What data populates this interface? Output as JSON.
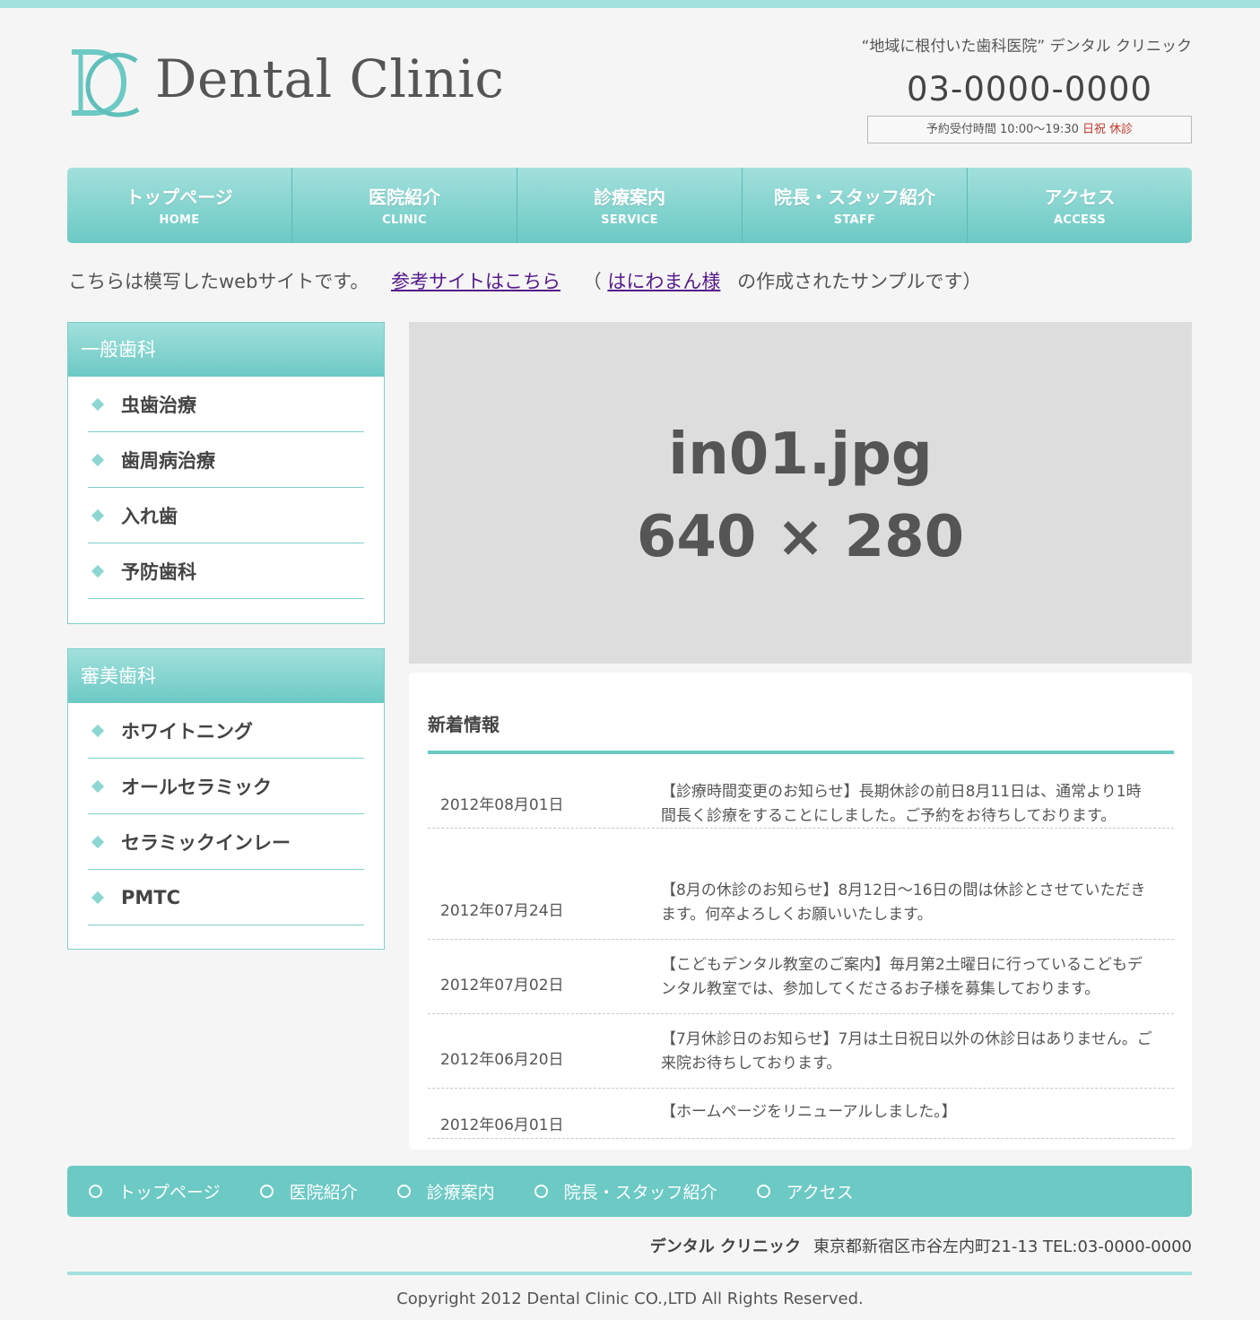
{
  "header": {
    "logo_text": "Dental Clinic",
    "tagline": "“地域に根付いた歯科医院” デンタル クリニック",
    "phone": "03-0000-0000",
    "hours_prefix": "予約受付時間 10:00～19:30 ",
    "hours_closed": "日祝 休診"
  },
  "nav": [
    {
      "jp": "トップページ",
      "en": "HOME"
    },
    {
      "jp": "医院紹介",
      "en": "CLINIC"
    },
    {
      "jp": "診療案内",
      "en": "SERVICE"
    },
    {
      "jp": "院長・スタッフ紹介",
      "en": "STAFF"
    },
    {
      "jp": "アクセス",
      "en": "ACCESS"
    }
  ],
  "notice": {
    "text1": "こちらは模写したwebサイトです。",
    "link1": "参考サイトはこちら",
    "paren_open": "（",
    "link2": "はにわまん様",
    "text2": "の作成されたサンプルです）"
  },
  "sidebar": {
    "general": {
      "title": "一般歯科",
      "items": [
        "虫歯治療",
        "歯周病治療",
        "入れ歯",
        "予防歯科"
      ]
    },
    "cosmetic": {
      "title": "審美歯科",
      "items": [
        "ホワイトニング",
        "オールセラミック",
        "セラミックインレー",
        "PMTC"
      ]
    }
  },
  "main_image": {
    "line1": "in01.jpg",
    "line2": "640 × 280"
  },
  "news": {
    "title": "新着情報",
    "items": [
      {
        "date": "2012年08月01日",
        "text": "【診療時間変更のお知らせ】長期休診の前日8月11日は、通常より1時間長く診療をすることにしました。ご予約をお待ちしております。"
      },
      {
        "date": "2012年07月24日",
        "text": "【8月の休診のお知らせ】8月12日～16日の間は休診とさせていただきます。何卒よろしくお願いいたします。"
      },
      {
        "date": "2012年07月02日",
        "text": "【こどもデンタル教室のご案内】毎月第2土曜日に行っているこどもデンタル教室では、参加してくださるお子様を募集しております。"
      },
      {
        "date": "2012年06月20日",
        "text": "【7月休診日のお知らせ】7月は土日祝日以外の休診日はありません。ご来院お待ちしております。"
      },
      {
        "date": "2012年06月01日",
        "text": "【ホームページをリニューアルしました。】"
      }
    ]
  },
  "footer": {
    "nav": [
      "トップページ",
      "医院紹介",
      "診療案内",
      "院長・スタッフ紹介",
      "アクセス"
    ],
    "clinic_name": "デンタル クリニック",
    "address": "東京都新宿区市谷左内町21-13 TEL:03-0000-0000",
    "copyright": "Copyright 2012 Dental Clinic CO.,LTD All Rights Reserved."
  },
  "colors": {
    "accent": "#6cc9c4",
    "accent_light": "#a4e2df",
    "background": "#f5f5f5",
    "closed_red": "#c0392b",
    "link": "#551a8b"
  }
}
